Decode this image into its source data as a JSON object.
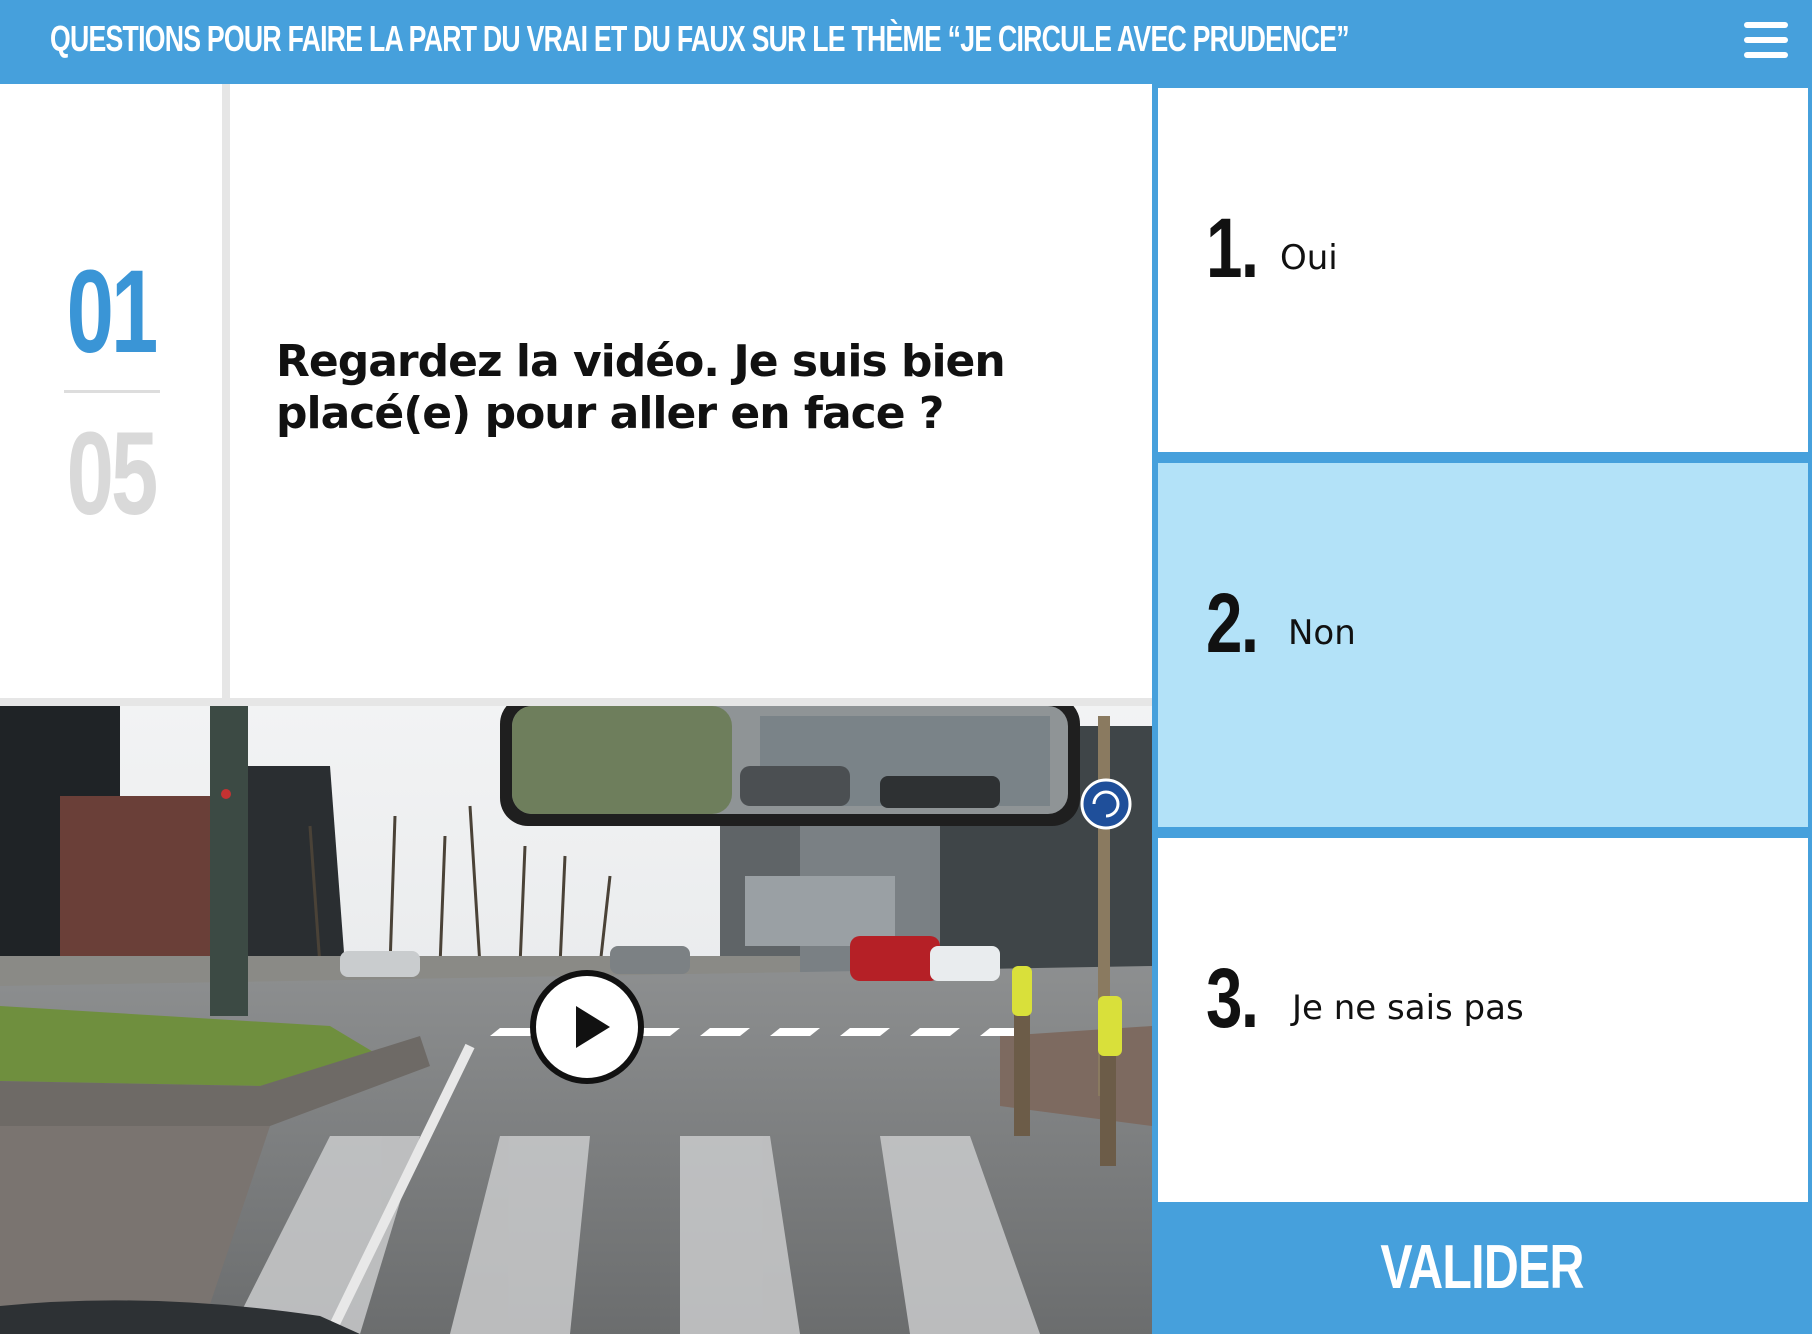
{
  "header": {
    "title": "QUESTIONS POUR FAIRE LA PART DU VRAI ET DU FAUX SUR LE THÈME “JE CIRCULE AVEC PRUDENCE”",
    "menu_icon": "hamburger-menu-icon"
  },
  "progress": {
    "current": "01",
    "total": "05"
  },
  "question": {
    "text": "Regardez la vidéo. Je suis bien placé(e) pour aller en face ?"
  },
  "video": {
    "play_icon": "play-icon"
  },
  "answers": [
    {
      "number": "1.",
      "label": "Oui",
      "selected": false
    },
    {
      "number": "2.",
      "label": "Non",
      "selected": true
    },
    {
      "number": "3.",
      "label": "Je ne sais pas",
      "selected": false
    }
  ],
  "actions": {
    "validate_label": "VALIDER"
  },
  "colors": {
    "accent": "#46a0dc",
    "selected_answer": "#b3e2f8",
    "counter_current": "#3a95d6",
    "counter_total": "#d9d9d9"
  }
}
